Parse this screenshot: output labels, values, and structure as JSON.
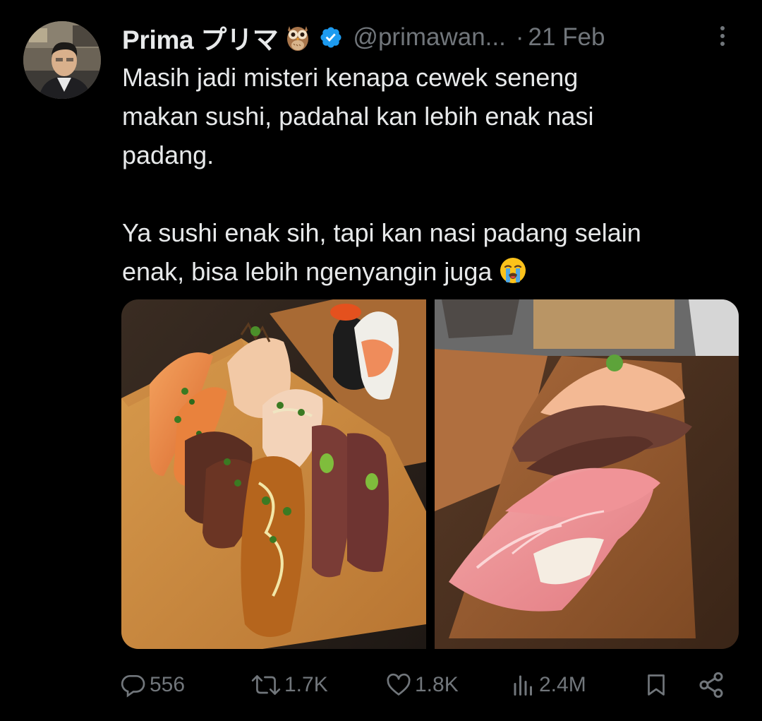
{
  "tweet": {
    "author": {
      "display_name": "Prima プリマ",
      "badge_emoji": "owl-emoji",
      "verified_icon": "verified-badge-icon",
      "handle": "@primawan...",
      "date_separator": "·",
      "date": "21 Feb"
    },
    "text": {
      "paragraph_1": "Masih jadi misteri kenapa cewek seneng\nmakan sushi, padahal kan lebih enak nasi\npadang.",
      "paragraph_2": "Ya sushi enak sih, tapi kan nasi padang selain\nenak, bisa lebih ngenyangin juga",
      "trailing_emoji": "loudly-crying-face-emoji"
    },
    "media": [
      {
        "icon": "photo-sushi-platter-assorted"
      },
      {
        "icon": "photo-sushi-platter-tuna-beef"
      }
    ],
    "actions": {
      "replies": "556",
      "reposts": "1.7K",
      "likes": "1.8K",
      "views": "2.4M"
    },
    "colors": {
      "background": "#000000",
      "text": "#e7e9ea",
      "muted": "#71767b",
      "verified": "#1d9bf0"
    }
  }
}
